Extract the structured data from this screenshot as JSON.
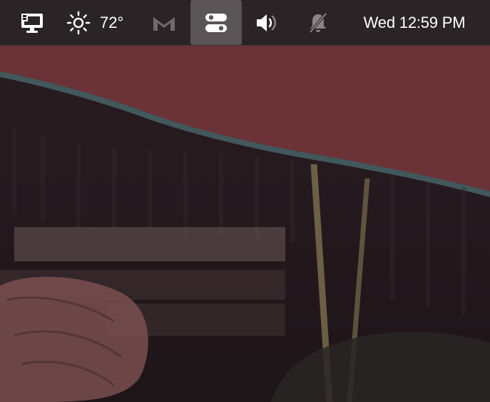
{
  "menubar": {
    "display_icon": "display-settings-icon",
    "weather": {
      "icon": "sun-icon",
      "temperature": "72°"
    },
    "mail_icon": "gmail-icon",
    "controls_icon": "control-center-toggles-icon",
    "controls_active": true,
    "volume_icon": "speaker-volume-icon",
    "notifications_icon": "notifications-muted-icon",
    "clock": "Wed 12:59 PM"
  },
  "colors": {
    "menubar_bg": "#2b2426",
    "active_highlight": "#5a5456",
    "mail_icon_dim": "#6f6a6b",
    "wallpaper_awning": "#6b3337",
    "wallpaper_dark": "#1e1519"
  }
}
